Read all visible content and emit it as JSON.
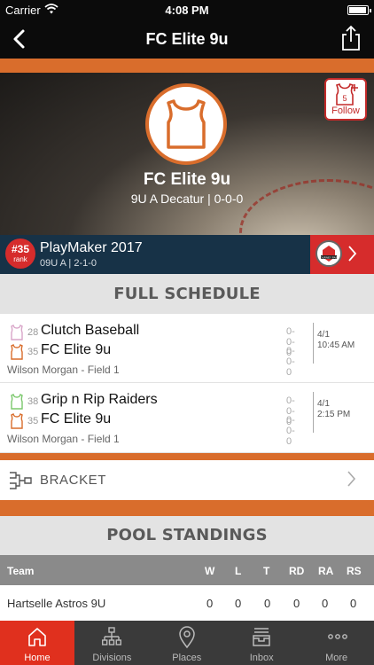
{
  "status_bar": {
    "carrier": "Carrier",
    "time": "4:08 PM"
  },
  "nav": {
    "title": "FC Elite 9u"
  },
  "team": {
    "name": "FC Elite 9u",
    "subtitle": "9U A Decatur | 0-0-0",
    "follow_label": "Follow",
    "follow_count": "5"
  },
  "event": {
    "rank": "#35",
    "rank_label": "rank",
    "name": "PlayMaker 2017",
    "details": "09U A | 2-1-0",
    "badge": "TOURNEY PASS"
  },
  "schedule": {
    "header": "FULL SCHEDULE",
    "games": [
      {
        "teams": [
          {
            "seed": "28",
            "name": "Clutch Baseball",
            "score": "0-0-0",
            "icon_color": "#d9a6c9"
          },
          {
            "seed": "35",
            "name": "FC Elite 9u",
            "score": "0-0-0",
            "icon_color": "#d96d2c"
          }
        ],
        "date": "4/1",
        "time": "10:45 AM",
        "venue": "Wilson Morgan - Field 1"
      },
      {
        "teams": [
          {
            "seed": "38",
            "name": "Grip n Rip Raiders",
            "score": "0-0-0",
            "icon_color": "#7bc86c"
          },
          {
            "seed": "35",
            "name": "FC Elite 9u",
            "score": "0-0-0",
            "icon_color": "#d96d2c"
          }
        ],
        "date": "4/1",
        "time": "2:15 PM",
        "venue": "Wilson Morgan - Field 1"
      }
    ]
  },
  "bracket": {
    "label": "BRACKET"
  },
  "standings": {
    "header": "POOL STANDINGS",
    "columns": [
      "Team",
      "W",
      "L",
      "T",
      "RD",
      "RA",
      "RS"
    ],
    "rows": [
      {
        "team": "Hartselle Astros 9U",
        "w": "0",
        "l": "0",
        "t": "0",
        "rd": "0",
        "ra": "0",
        "rs": "0"
      }
    ]
  },
  "tabs": [
    {
      "label": "Home",
      "icon": "home-icon"
    },
    {
      "label": "Divisions",
      "icon": "divisions-icon"
    },
    {
      "label": "Places",
      "icon": "map-pin-icon"
    },
    {
      "label": "Inbox",
      "icon": "inbox-icon"
    },
    {
      "label": "More",
      "icon": "more-icon"
    }
  ],
  "colors": {
    "accent": "#d96d2c",
    "tab_active": "#e0301e",
    "event_bar": "#173247",
    "rank_badge": "#d62c2c"
  }
}
